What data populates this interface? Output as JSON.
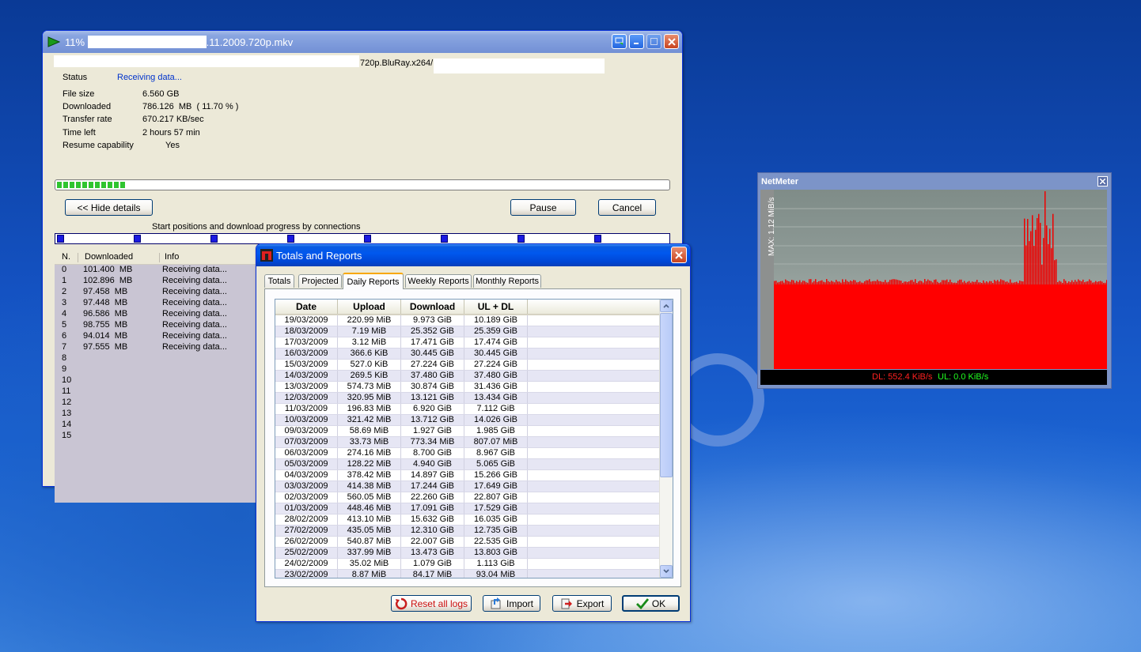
{
  "download": {
    "title": "11% ",
    "title_suffix": ".11.2009.720p.mkv",
    "url_fragment": "720p.BluRay.x264/",
    "status_label": "Status",
    "status_value": "Receiving data...",
    "fields": [
      {
        "label": "File size",
        "value": "6.560  GB"
      },
      {
        "label": "Downloaded",
        "value": "786.126  MB  ( 11.70 % )"
      },
      {
        "label": "Transfer rate",
        "value": "670.217  KB/sec"
      },
      {
        "label": "Time left",
        "value": "2 hours 57 min"
      }
    ],
    "resume_label": "Resume capability",
    "resume_value": "Yes",
    "progress_percent": 11.7,
    "hide_details_label": "<< Hide details",
    "pause_label": "Pause",
    "cancel_label": "Cancel",
    "connections_caption": "Start positions and download progress by connections",
    "columns": {
      "n": "N.",
      "downloaded": "Downloaded",
      "info": "Info"
    },
    "connections": [
      {
        "n": "0",
        "downloaded": "101.400  MB",
        "info": "Receiving data..."
      },
      {
        "n": "1",
        "downloaded": "102.896  MB",
        "info": "Receiving data..."
      },
      {
        "n": "2",
        "downloaded": "97.458  MB",
        "info": "Receiving data..."
      },
      {
        "n": "3",
        "downloaded": "97.448  MB",
        "info": "Receiving data..."
      },
      {
        "n": "4",
        "downloaded": "96.586  MB",
        "info": "Receiving data..."
      },
      {
        "n": "5",
        "downloaded": "98.755  MB",
        "info": "Receiving data..."
      },
      {
        "n": "6",
        "downloaded": "94.014  MB",
        "info": "Receiving data..."
      },
      {
        "n": "7",
        "downloaded": "97.555  MB",
        "info": "Receiving data..."
      },
      {
        "n": "8",
        "downloaded": "",
        "info": ""
      },
      {
        "n": "9",
        "downloaded": "",
        "info": ""
      },
      {
        "n": "10",
        "downloaded": "",
        "info": ""
      },
      {
        "n": "11",
        "downloaded": "",
        "info": ""
      },
      {
        "n": "12",
        "downloaded": "",
        "info": ""
      },
      {
        "n": "13",
        "downloaded": "",
        "info": ""
      },
      {
        "n": "14",
        "downloaded": "",
        "info": ""
      },
      {
        "n": "15",
        "downloaded": "",
        "info": ""
      }
    ]
  },
  "netmeter": {
    "title": "NetMeter",
    "max_label": "MAX: 1.12 MiB/s",
    "dl_label": "DL: 552.4 KiB/s",
    "ul_label": "UL: 0.0 KiB/s",
    "dl_color": "#ff0000",
    "ul_color": "#00ff00"
  },
  "totals": {
    "title": "Totals and Reports",
    "tabs": [
      "Totals",
      "Projected",
      "Daily Reports",
      "Weekly Reports",
      "Monthly Reports"
    ],
    "active_tab": "Daily Reports",
    "columns": [
      "Date",
      "Upload",
      "Download",
      "UL + DL"
    ],
    "rows": [
      [
        "19/03/2009",
        "220.99 MiB",
        "9.973 GiB",
        "10.189 GiB"
      ],
      [
        "18/03/2009",
        "7.19 MiB",
        "25.352 GiB",
        "25.359 GiB"
      ],
      [
        "17/03/2009",
        "3.12 MiB",
        "17.471 GiB",
        "17.474 GiB"
      ],
      [
        "16/03/2009",
        "366.6 KiB",
        "30.445 GiB",
        "30.445 GiB"
      ],
      [
        "15/03/2009",
        "527.0 KiB",
        "27.224 GiB",
        "27.224 GiB"
      ],
      [
        "14/03/2009",
        "269.5 KiB",
        "37.480 GiB",
        "37.480 GiB"
      ],
      [
        "13/03/2009",
        "574.73 MiB",
        "30.874 GiB",
        "31.436 GiB"
      ],
      [
        "12/03/2009",
        "320.95 MiB",
        "13.121 GiB",
        "13.434 GiB"
      ],
      [
        "11/03/2009",
        "196.83 MiB",
        "6.920 GiB",
        "7.112 GiB"
      ],
      [
        "10/03/2009",
        "321.42 MiB",
        "13.712 GiB",
        "14.026 GiB"
      ],
      [
        "09/03/2009",
        "58.69 MiB",
        "1.927 GiB",
        "1.985 GiB"
      ],
      [
        "07/03/2009",
        "33.73 MiB",
        "773.34 MiB",
        "807.07 MiB"
      ],
      [
        "06/03/2009",
        "274.16 MiB",
        "8.700 GiB",
        "8.967 GiB"
      ],
      [
        "05/03/2009",
        "128.22 MiB",
        "4.940 GiB",
        "5.065 GiB"
      ],
      [
        "04/03/2009",
        "378.42 MiB",
        "14.897 GiB",
        "15.266 GiB"
      ],
      [
        "03/03/2009",
        "414.38 MiB",
        "17.244 GiB",
        "17.649 GiB"
      ],
      [
        "02/03/2009",
        "560.05 MiB",
        "22.260 GiB",
        "22.807 GiB"
      ],
      [
        "01/03/2009",
        "448.46 MiB",
        "17.091 GiB",
        "17.529 GiB"
      ],
      [
        "28/02/2009",
        "413.10 MiB",
        "15.632 GiB",
        "16.035 GiB"
      ],
      [
        "27/02/2009",
        "435.05 MiB",
        "12.310 GiB",
        "12.735 GiB"
      ],
      [
        "26/02/2009",
        "540.87 MiB",
        "22.007 GiB",
        "22.535 GiB"
      ],
      [
        "25/02/2009",
        "337.99 MiB",
        "13.473 GiB",
        "13.803 GiB"
      ],
      [
        "24/02/2009",
        "35.02 MiB",
        "1.079 GiB",
        "1.113 GiB"
      ],
      [
        "23/02/2009",
        "8.87 MiB",
        "84.17 MiB",
        "93.04 MiB"
      ]
    ],
    "buttons": {
      "reset": "Reset all logs",
      "import": "Import",
      "export": "Export",
      "ok": "OK"
    }
  }
}
